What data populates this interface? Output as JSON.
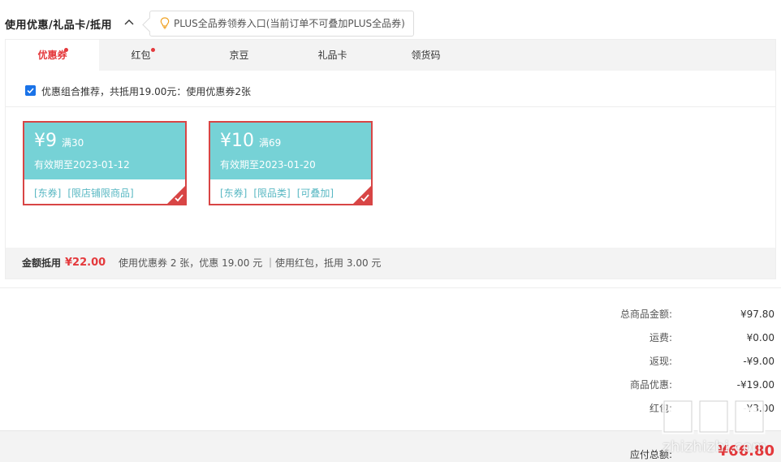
{
  "header": {
    "title": "使用优惠/礼品卡/抵用",
    "toggle_icon": "chevron-up-icon",
    "plus_tip": "PLUS全品券领券入口(当前订单不可叠加PLUS全品券)",
    "tip_icon": "lightbulb-icon"
  },
  "tabs": [
    {
      "label": "优惠券",
      "active": true,
      "has_dot": true
    },
    {
      "label": "红包",
      "active": false,
      "has_dot": true
    },
    {
      "label": "京豆",
      "active": false,
      "has_dot": false
    },
    {
      "label": "礼品卡",
      "active": false,
      "has_dot": false
    },
    {
      "label": "领货码",
      "active": false,
      "has_dot": false
    }
  ],
  "combo": {
    "checked": true,
    "text": "优惠组合推荐，共抵用19.00元：使用优惠券2张"
  },
  "coupons": [
    {
      "amount": "¥9",
      "condition": "满30",
      "valid": "有效期至2023-01-12",
      "tags": [
        "[东券]",
        "[限店铺限商品]"
      ],
      "selected": true
    },
    {
      "amount": "¥10",
      "condition": "满69",
      "valid": "有效期至2023-01-20",
      "tags": [
        "[东券]",
        "[限品类]",
        "[可叠加]"
      ],
      "selected": true
    }
  ],
  "footer": {
    "label": "金额抵用",
    "amount": "¥22.00",
    "desc": "使用优惠券 2 张，优惠 19.00 元 ｜使用红包，抵用 3.00 元"
  },
  "summary": [
    {
      "label": "总商品金额:",
      "value": "¥97.80"
    },
    {
      "label": "运费:",
      "value": "¥0.00"
    },
    {
      "label": "返现:",
      "value": "-¥9.00"
    },
    {
      "label": "商品优惠:",
      "value": "-¥19.00"
    },
    {
      "label": "红包:",
      "value": "-¥3.00"
    }
  ],
  "total": {
    "label": "应付总额:",
    "value": "¥66.80"
  },
  "watermark": {
    "text": "zhizhizhi.com"
  },
  "colors": {
    "accent_red": "#e4393c",
    "coupon_teal": "#76d2d6",
    "coupon_border": "#d84545",
    "checkbox_blue": "#1a73e8"
  }
}
